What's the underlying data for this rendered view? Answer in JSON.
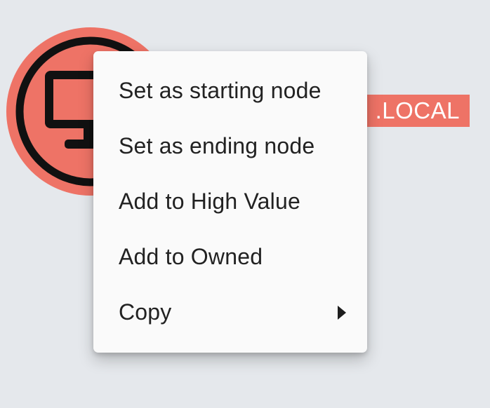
{
  "node": {
    "icon": "computer-icon",
    "label_visible": ".LOCAL",
    "ring_color": "#ee7366"
  },
  "context_menu": {
    "items": [
      {
        "label": "Set as starting node"
      },
      {
        "label": "Set as ending node"
      },
      {
        "label": "Add to High Value"
      },
      {
        "label": "Add to Owned"
      },
      {
        "label": "Copy",
        "submenu_icon": "caret-right-icon"
      }
    ]
  }
}
